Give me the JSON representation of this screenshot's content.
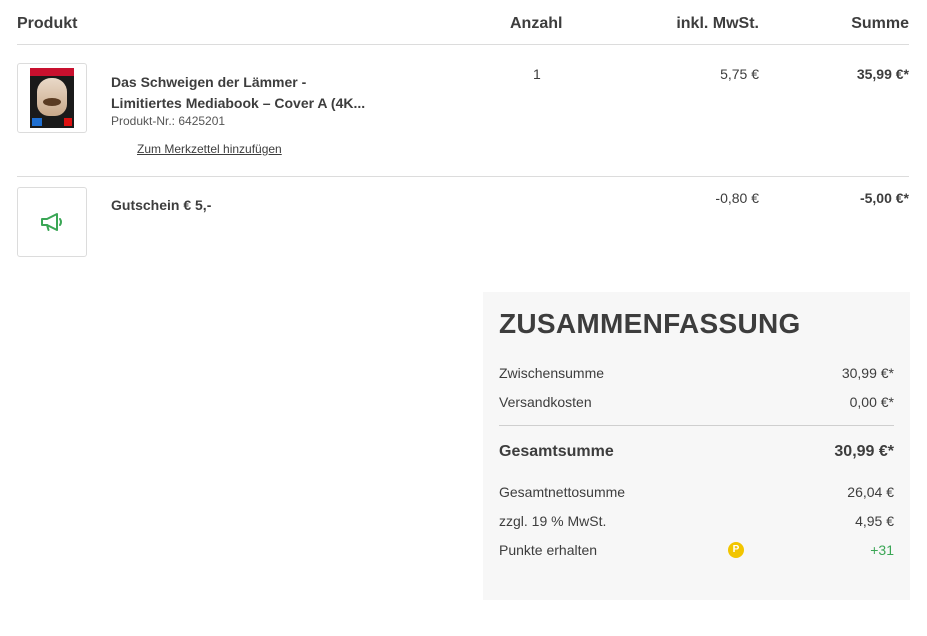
{
  "columns": {
    "product": "Produkt",
    "quantity": "Anzahl",
    "tax": "inkl. MwSt.",
    "sum": "Summe"
  },
  "items": [
    {
      "title_line1": "Das Schweigen der Lämmer -",
      "title_line2": "Limitiertes Mediabook – Cover A (4K...",
      "sku": "Produkt-Nr.: 6425201",
      "wishlist_link": "Zum Merkzettel hinzufügen",
      "quantity": "1",
      "tax": "5,75 €",
      "sum": "35,99 €*"
    },
    {
      "title": "Gutschein € 5,-",
      "icon": "megaphone-icon",
      "tax": "-0,80 €",
      "sum": "-5,00 €*"
    }
  ],
  "summary": {
    "heading": "ZUSAMMENFASSUNG",
    "subtotal_label": "Zwischensumme",
    "subtotal_value": "30,99 €*",
    "shipping_label": "Versandkosten",
    "shipping_value": "0,00 €*",
    "total_label": "Gesamtsumme",
    "total_value": "30,99 €*",
    "net_label": "Gesamtnettosumme",
    "net_value": "26,04 €",
    "vat_label": "zzgl. 19 % MwSt.",
    "vat_value": "4,95 €",
    "points_label": "Punkte erhalten",
    "points_icon_letter": "P",
    "points_value": "+31"
  },
  "colors": {
    "accent_green": "#3aa655",
    "points_gold": "#f2c500",
    "text": "#3d3d3d"
  }
}
